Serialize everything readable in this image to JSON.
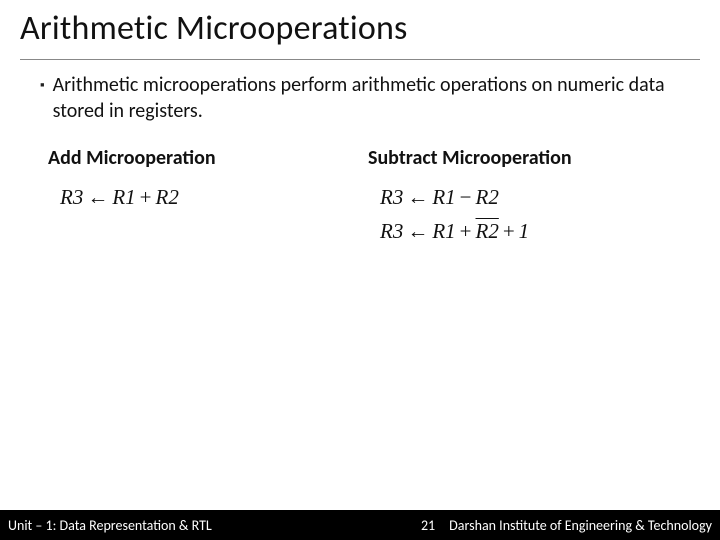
{
  "title": "Arithmetic Microoperations",
  "bullet": {
    "marker": "▪",
    "text": "Arithmetic microoperations perform arithmetic operations on numeric data stored in registers."
  },
  "columns": {
    "left": {
      "title": "Add Microoperation",
      "eq1": {
        "lhs": "R3",
        "arrow": "←",
        "r1": "R1",
        "op": "+",
        "r2": "R2"
      }
    },
    "right": {
      "title": "Subtract Microoperation",
      "eq1": {
        "lhs": "R3",
        "arrow": "←",
        "r1": "R1",
        "op": "−",
        "r2": "R2"
      },
      "eq2": {
        "lhs": "R3",
        "arrow": "←",
        "r1": "R1",
        "op1": "+",
        "r2bar": "R2",
        "op2": "+",
        "one": "1"
      }
    }
  },
  "footer": {
    "unit": "Unit – 1: Data Representation & RTL",
    "page": "21",
    "org": "Darshan Institute of Engineering & Technology"
  }
}
